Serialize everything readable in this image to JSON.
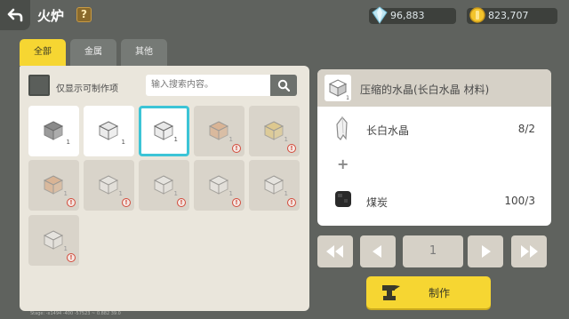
{
  "header": {
    "title": "火炉",
    "help_label": "?",
    "diamonds": "96,883",
    "gold": "823,707"
  },
  "tabs": [
    {
      "label": "全部",
      "active": true
    },
    {
      "label": "金属",
      "active": false
    },
    {
      "label": "其他",
      "active": false
    }
  ],
  "filter": {
    "label": "仅显示可制作项",
    "search_placeholder": "输入搜索内容。"
  },
  "items": [
    {
      "state": "available",
      "count": "1",
      "color": "#8a8a8a"
    },
    {
      "state": "available",
      "count": "1",
      "color": "#e8e8e8"
    },
    {
      "state": "selected",
      "count": "1",
      "color": "#e8e8e8"
    },
    {
      "state": "locked",
      "count": "1",
      "color": "#d99a6a"
    },
    {
      "state": "locked",
      "count": "1",
      "color": "#e2c060"
    },
    {
      "state": "locked",
      "count": "1",
      "color": "#d99a6a"
    },
    {
      "state": "locked",
      "count": "1",
      "color": "#f0f0f0"
    },
    {
      "state": "locked",
      "count": "1",
      "color": "#f0f0f0"
    },
    {
      "state": "locked",
      "count": "1",
      "color": "#f0f0f0"
    },
    {
      "state": "locked",
      "count": "1",
      "color": "#f0f0f0"
    },
    {
      "state": "locked",
      "count": "1",
      "color": "#f0f0f0"
    }
  ],
  "warn_symbol": "!",
  "stage_text": "Stage: -x1494 -400 -57523 ~ 0.882 39.0",
  "recipe": {
    "title": "压缩的水晶(长白水晶 材料)",
    "count_badge": "1",
    "ingredients": [
      {
        "name": "长白水晶",
        "count": "8/2"
      },
      {
        "name": "煤炭",
        "count": "100/3"
      }
    ],
    "plus": "+"
  },
  "pager": {
    "page": "1"
  },
  "craft": {
    "label": "制作"
  },
  "colors": {
    "accent_yellow": "#f6d632",
    "selected_border": "#3cc4d6",
    "warning_red": "#d24a3a"
  }
}
